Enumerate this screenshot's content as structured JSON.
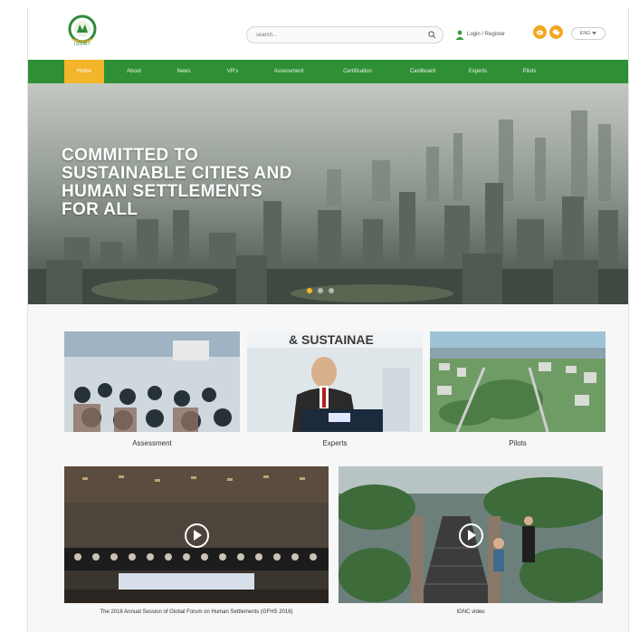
{
  "header": {
    "logo_text": "ISOMT",
    "search_placeholder": "search...",
    "user_links": "Login / Register",
    "lang": "ENG"
  },
  "nav": {
    "items": [
      "Home",
      "About",
      "News",
      "VR's",
      "Assessment",
      "Certification",
      "Cardboard",
      "Experts",
      "Pilots"
    ]
  },
  "hero": {
    "title": "COMMITTED TO SUSTAINABLE CITIES AND HUMAN SETTLEMENTS FOR ALL"
  },
  "cards": [
    {
      "caption": "Assessment"
    },
    {
      "caption": "Experts",
      "banner": "& SUSTAINAE"
    },
    {
      "caption": "Pilots"
    }
  ],
  "videos": [
    {
      "caption": "The 2016 Annual Session of Global Forum on Human Settlements (GFHS 2016)"
    },
    {
      "caption": "IGNC video"
    }
  ],
  "colors": {
    "nav_green": "#2f8f35",
    "accent_orange": "#f3b62a"
  },
  "icons": [
    "search-icon",
    "user-icon",
    "weibo-icon",
    "wechat-icon",
    "chevron-down-icon",
    "play-icon"
  ]
}
